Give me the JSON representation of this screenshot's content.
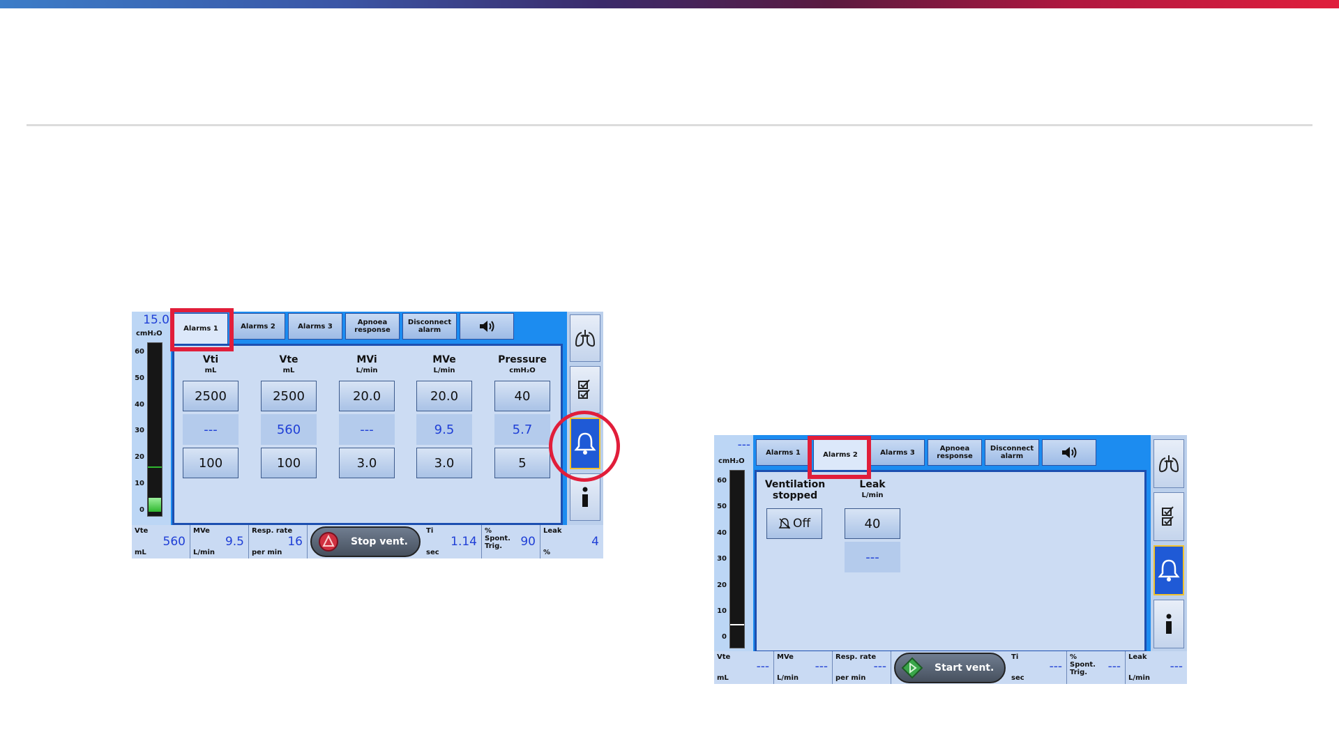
{
  "screen1": {
    "gauge": {
      "value": "15.0",
      "unit": "cmH₂O",
      "ticks": [
        "60",
        "50",
        "40",
        "30",
        "20",
        "10",
        "0"
      ],
      "fill_level": 0.1
    },
    "tabs": [
      "Alarms 1",
      "Alarms 2",
      "Alarms 3",
      "Apnoea response",
      "Disconnect alarm"
    ],
    "active_tab": "Alarms 1",
    "sound_icon": "speaker-icon",
    "columns": [
      {
        "title": "Vti",
        "unit": "mL",
        "high": "2500",
        "measured": "---",
        "low": "100"
      },
      {
        "title": "Vte",
        "unit": "mL",
        "high": "2500",
        "measured": "560",
        "low": "100"
      },
      {
        "title": "MVi",
        "unit": "L/min",
        "high": "20.0",
        "measured": "---",
        "low": "3.0"
      },
      {
        "title": "MVe",
        "unit": "L/min",
        "high": "20.0",
        "measured": "9.5",
        "low": "3.0"
      },
      {
        "title": "Pressure",
        "unit": "cmH₂O",
        "high": "40",
        "measured": "5.7",
        "low": "5"
      }
    ],
    "side_icons": [
      "lungs-icon",
      "checklist-icon",
      "alarm-bell-icon",
      "info-icon"
    ],
    "bottom": [
      {
        "label": "Vte",
        "unit": "mL",
        "value": "560"
      },
      {
        "label": "MVe",
        "unit": "L/min",
        "value": "9.5"
      },
      {
        "label": "Resp. rate",
        "unit": "per min",
        "value": "16"
      },
      {
        "label": "Ti",
        "unit": "sec",
        "value": "1.14"
      },
      {
        "label": "% Spont. Trig.",
        "unit": "",
        "value": "90"
      },
      {
        "label": "Leak",
        "unit": "%",
        "value": "4"
      }
    ],
    "vent_button": "Stop vent."
  },
  "screen2": {
    "gauge": {
      "value": "---",
      "unit": "cmH₂O",
      "ticks": [
        "60",
        "50",
        "40",
        "30",
        "20",
        "10",
        "0"
      ],
      "fill_level": 0.0
    },
    "tabs": [
      "Alarms 1",
      "Alarms 2",
      "Alarms 3",
      "Apnoea response",
      "Disconnect alarm"
    ],
    "active_tab": "Alarms 2",
    "sound_icon": "speaker-icon",
    "vent_stopped": {
      "title": "Ventilation stopped",
      "value": "Off"
    },
    "leak": {
      "title": "Leak",
      "unit": "L/min",
      "value": "40",
      "measured": "---"
    },
    "side_icons": [
      "lungs-icon",
      "checklist-icon",
      "alarm-bell-icon",
      "info-icon"
    ],
    "bottom": [
      {
        "label": "Vte",
        "unit": "mL",
        "value": "---"
      },
      {
        "label": "MVe",
        "unit": "L/min",
        "value": "---"
      },
      {
        "label": "Resp. rate",
        "unit": "per min",
        "value": "---"
      },
      {
        "label": "Ti",
        "unit": "sec",
        "value": "---"
      },
      {
        "label": "% Spont. Trig.",
        "unit": "",
        "value": "---"
      },
      {
        "label": "Leak",
        "unit": "L/min",
        "value": "---"
      }
    ],
    "vent_button": "Start vent."
  },
  "colors": {
    "highlight": "#e11e3a",
    "screen_blue": "#1c8cf0",
    "value_blue": "#1f3fd6"
  }
}
